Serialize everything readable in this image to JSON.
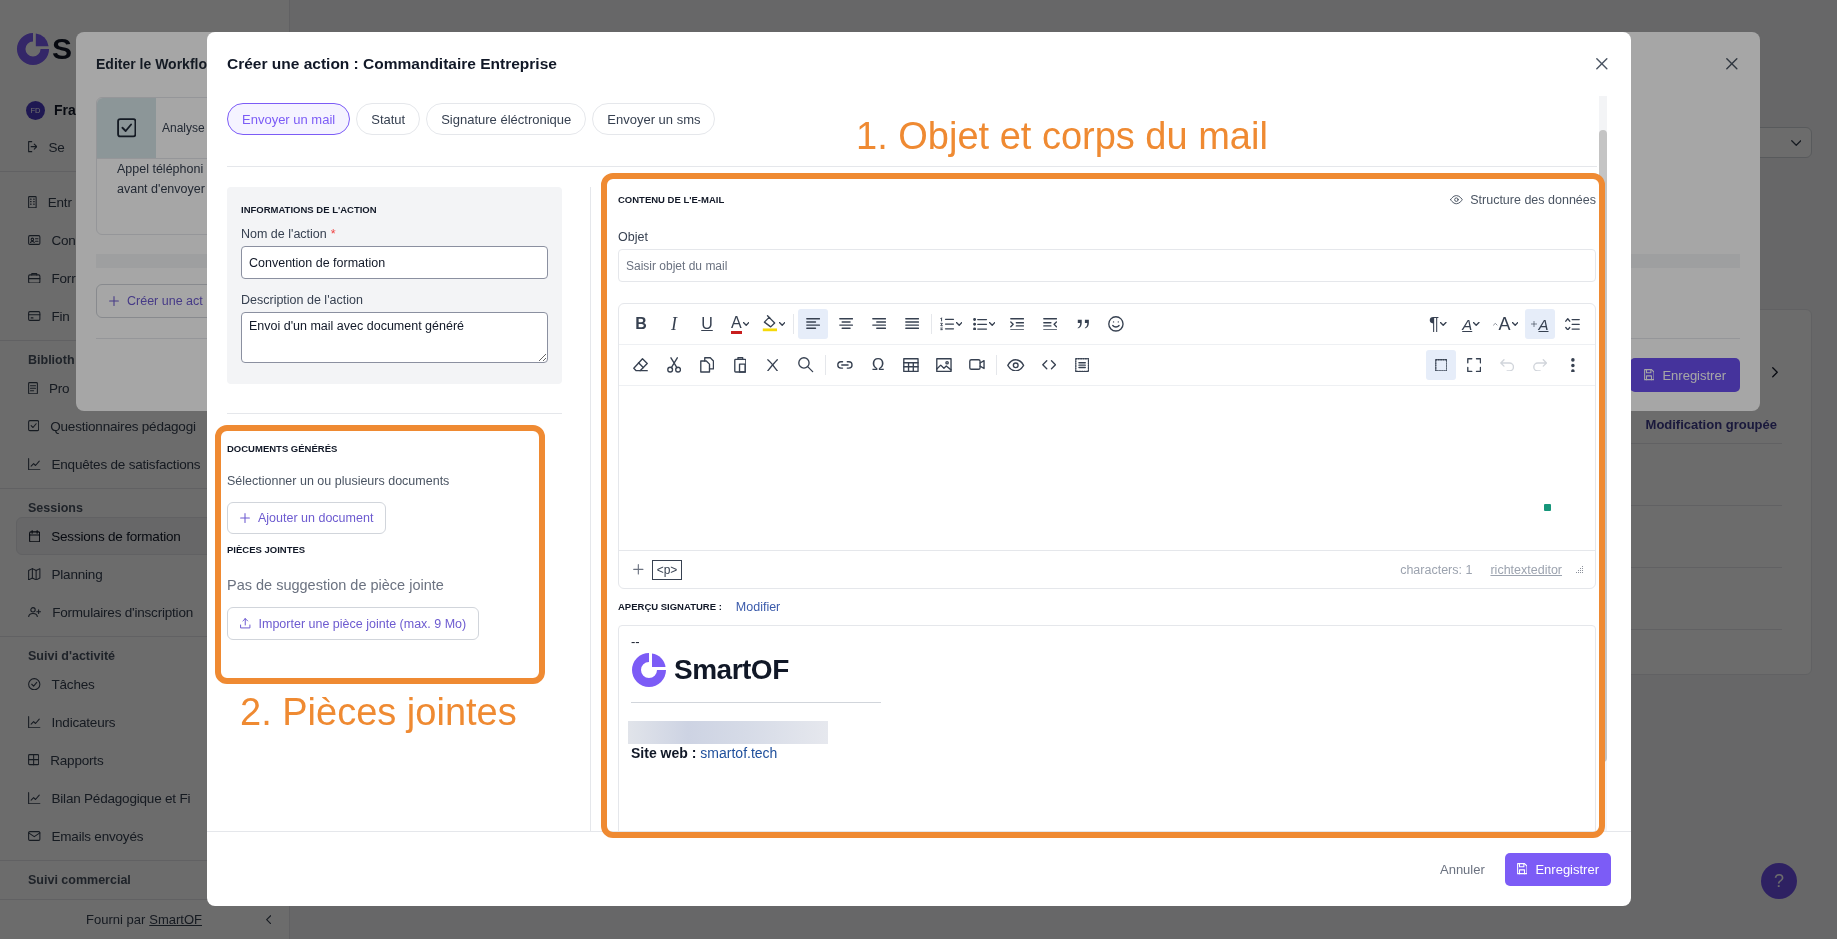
{
  "sidebar": {
    "logo": "S",
    "user": {
      "initials": "FD",
      "name": "Fra"
    },
    "logout": "Se",
    "sections": [
      {
        "items": [
          {
            "kind": "building",
            "label": "Entr",
            "selected": false
          },
          {
            "kind": "id-card",
            "label": "Con",
            "selected": false
          },
          {
            "kind": "briefcase",
            "label": "Forr",
            "selected": false
          },
          {
            "kind": "card",
            "label": "Fin",
            "selected": false
          }
        ]
      },
      {
        "title": "Biblioth",
        "items": [
          {
            "kind": "document",
            "label": "Pro",
            "selected": false
          },
          {
            "kind": "checkbox",
            "label": "Questionnaires pédagogi",
            "selected": false
          },
          {
            "kind": "chart",
            "label": "Enquêtes de satisfactions",
            "selected": false
          }
        ]
      },
      {
        "title": "Sessions",
        "items": [
          {
            "kind": "calendar",
            "label": "Sessions de formation",
            "selected": true
          },
          {
            "kind": "map",
            "label": "Planning",
            "selected": false
          },
          {
            "kind": "user-plus",
            "label": "Formulaires d'inscription",
            "selected": false
          }
        ]
      },
      {
        "title": "Suivi d'activité",
        "items": [
          {
            "kind": "check-circle",
            "label": "Tâches",
            "selected": false
          },
          {
            "kind": "chart",
            "label": "Indicateurs",
            "selected": false
          },
          {
            "kind": "grid",
            "label": "Rapports",
            "selected": false
          },
          {
            "kind": "chart",
            "label": "Bilan Pédagogique et Fi",
            "selected": false
          },
          {
            "kind": "mail",
            "label": "Emails envoyés",
            "selected": false
          }
        ]
      },
      {
        "title": "Suivi commercial"
      }
    ],
    "footer": {
      "text": "Fourni par",
      "link": "SmartOF"
    }
  },
  "background": {
    "column_header": "Modification groupée",
    "help": "?"
  },
  "workflow_modal": {
    "title": "Editer le Workflo",
    "step": {
      "title": "Analyse",
      "lines": [
        "Appel téléphoni",
        "avant d'envoyer"
      ]
    },
    "create_button": "Créer une act",
    "save_button": "Enregistrer"
  },
  "action_modal": {
    "title": "Créer une action : Commanditaire Entreprise",
    "tabs": [
      {
        "label": "Envoyer un mail",
        "selected": true
      },
      {
        "label": "Statut",
        "selected": false
      },
      {
        "label": "Signature éléctronique",
        "selected": false
      },
      {
        "label": "Envoyer un sms",
        "selected": false
      }
    ],
    "info": {
      "heading": "INFORMATIONS DE L'ACTION",
      "name_label": "Nom de l'action",
      "required": "*",
      "name_value": "Convention de formation",
      "description_label": "Description de l'action",
      "description_value": "Envoi d'un mail avec document généré"
    },
    "documents": {
      "heading": "DOCUMENTS GÉNÉRÉS",
      "hint": "Sélectionner un ou plusieurs documents",
      "button": "Ajouter un document"
    },
    "attachments": {
      "heading": "PIÈCES JOINTES",
      "empty": "Pas de suggestion de pièce jointe",
      "button": "Importer une pièce jointe (max. 9 Mo)"
    },
    "email": {
      "heading": "CONTENU DE L'E-MAIL",
      "data_link": "Structure des données",
      "subject_label": "Objet",
      "subject_placeholder": "Saisir objet du mail",
      "editor": {
        "toolbar": [
          {
            "left": [
              [
                {
                  "kind": "bold",
                  "label": "B",
                  "dropdown": false,
                  "active": false,
                  "disabled": false
                },
                {
                  "kind": "italic",
                  "label": "I",
                  "dropdown": false,
                  "active": false,
                  "disabled": false
                },
                {
                  "kind": "underline",
                  "label": "U",
                  "dropdown": false,
                  "active": false,
                  "disabled": false
                },
                {
                  "kind": "font-color",
                  "label": "A",
                  "dropdown": true,
                  "active": false,
                  "disabled": false
                },
                {
                  "kind": "highlight",
                  "dropdown": true,
                  "active": false,
                  "disabled": false
                }
              ],
              [
                {
                  "kind": "align-left",
                  "dropdown": false,
                  "active": true,
                  "disabled": false
                },
                {
                  "kind": "align-center",
                  "dropdown": false,
                  "active": false,
                  "disabled": false
                },
                {
                  "kind": "align-right",
                  "dropdown": false,
                  "active": false,
                  "disabled": false
                },
                {
                  "kind": "justify",
                  "dropdown": false,
                  "active": false,
                  "disabled": false
                }
              ],
              [
                {
                  "kind": "ordered-list",
                  "dropdown": true,
                  "active": false,
                  "disabled": false
                },
                {
                  "kind": "bullet-list",
                  "dropdown": true,
                  "active": false,
                  "disabled": false
                },
                {
                  "kind": "indent",
                  "dropdown": false,
                  "active": false,
                  "disabled": false
                },
                {
                  "kind": "outdent",
                  "dropdown": false,
                  "active": false,
                  "disabled": false
                },
                {
                  "kind": "quote",
                  "dropdown": false,
                  "active": false,
                  "disabled": false
                },
                {
                  "kind": "emoji",
                  "dropdown": false,
                  "active": false,
                  "disabled": false
                }
              ]
            ],
            "right": [
              [
                {
                  "kind": "paragraph",
                  "label": "¶",
                  "dropdown": true,
                  "active": false,
                  "disabled": false
                },
                {
                  "kind": "font-ratio",
                  "label": "A",
                  "dropdown": true,
                  "active": false,
                  "disabled": false
                },
                {
                  "kind": "font-size",
                  "label": "A",
                  "dropdown": true,
                  "active": false,
                  "disabled": false
                },
                {
                  "kind": "add-format",
                  "label": "A",
                  "dropdown": false,
                  "active": true,
                  "disabled": false
                },
                {
                  "kind": "line-spacing",
                  "dropdown": false,
                  "active": false,
                  "disabled": false
                }
              ]
            ]
          },
          {
            "left": [
              [
                {
                  "kind": "eraser",
                  "dropdown": false,
                  "active": false,
                  "disabled": false
                },
                {
                  "kind": "cut",
                  "dropdown": false,
                  "active": false,
                  "disabled": false
                },
                {
                  "kind": "copy",
                  "dropdown": false,
                  "active": false,
                  "disabled": false
                },
                {
                  "kind": "paste",
                  "dropdown": false,
                  "active": false,
                  "disabled": false
                },
                {
                  "kind": "remove-format",
                  "dropdown": false,
                  "active": false,
                  "disabled": false
                },
                {
                  "kind": "find",
                  "dropdown": false,
                  "active": false,
                  "disabled": false
                }
              ],
              [
                {
                  "kind": "link",
                  "dropdown": false,
                  "active": false,
                  "disabled": false
                },
                {
                  "kind": "special-char",
                  "label": "Ω",
                  "dropdown": false,
                  "active": false,
                  "disabled": false
                },
                {
                  "kind": "table",
                  "dropdown": false,
                  "active": false,
                  "disabled": false
                },
                {
                  "kind": "image",
                  "dropdown": false,
                  "active": false,
                  "disabled": false
                },
                {
                  "kind": "video",
                  "dropdown": false,
                  "active": false,
                  "disabled": false
                }
              ],
              [
                {
                  "kind": "preview",
                  "dropdown": false,
                  "active": false,
                  "disabled": false
                },
                {
                  "kind": "code",
                  "dropdown": false,
                  "active": false,
                  "disabled": false
                },
                {
                  "kind": "show-blocks",
                  "dropdown": false,
                  "active": false,
                  "disabled": false
                }
              ]
            ],
            "right": [
              [
                {
                  "kind": "select-all",
                  "dropdown": false,
                  "active": true,
                  "disabled": false
                },
                {
                  "kind": "fullscreen",
                  "dropdown": false,
                  "active": false,
                  "disabled": false
                },
                {
                  "kind": "undo",
                  "dropdown": false,
                  "active": false,
                  "disabled": true
                },
                {
                  "kind": "redo",
                  "dropdown": false,
                  "active": false,
                  "disabled": true
                },
                {
                  "kind": "more",
                  "dropdown": false,
                  "active": false,
                  "disabled": false
                }
              ]
            ]
          }
        ],
        "footer_tag": "<p>",
        "characters": "characters: 1",
        "brand": "richtexteditor"
      },
      "signature": {
        "heading": "APERÇU SIGNATURE :",
        "edit_link": "Modifier",
        "dashes": "--",
        "logo": "SmartOF",
        "site_label": "Site web :",
        "site_link": "smartof.tech"
      }
    },
    "footer": {
      "cancel": "Annuler",
      "save": "Enregistrer"
    }
  },
  "annotations": [
    {
      "text": "1. Objet et corps du mail"
    },
    {
      "text": "2. Pièces jointes"
    }
  ]
}
